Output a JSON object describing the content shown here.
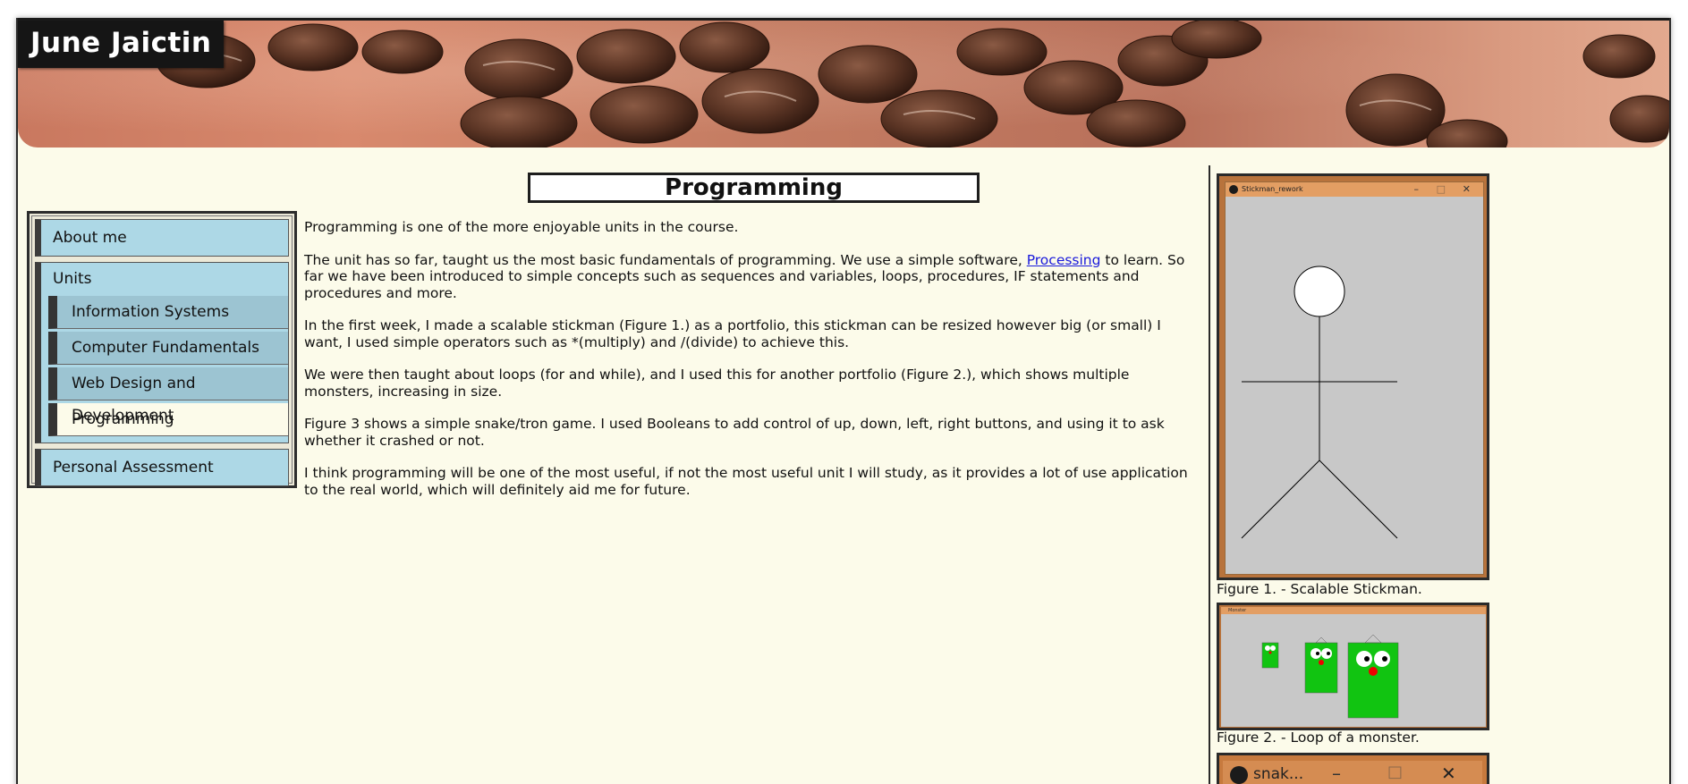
{
  "site": {
    "title": "June Jaictin"
  },
  "nav": {
    "about": "About me",
    "units": {
      "label": "Units",
      "items": [
        {
          "label": "Information Systems"
        },
        {
          "label": "Computer Fundamentals"
        },
        {
          "label": "Web Design and Development"
        },
        {
          "label": "Programming"
        }
      ]
    },
    "assessment": "Personal Assessment"
  },
  "page": {
    "heading": "Programming",
    "p1": "Programming is one of the more enjoyable units in the course.",
    "p2_a": "The unit has so far, taught us the most basic fundamentals of programming. We use a simple software, ",
    "p2_link": "Processing",
    "p2_b": " to learn. So far we have been introduced to simple concepts such as sequences and variables, loops, procedures, IF statements and procedures and more.",
    "p3": "In the first week, I made a scalable stickman (Figure 1.) as a portfolio, this stickman can be resized however big (or small) I want, I used simple operators such as *(multiply) and /(divide) to achieve this.",
    "p4": "We were then taught about loops (for and while), and I used this for another portfolio (Figure 2.), which shows multiple monsters, increasing in size.",
    "p5": "Figure 3 shows a simple snake/tron game. I used Booleans to add control of up, down, left, right buttons, and using it to ask whether it crashed or not.",
    "p6": "I think programming will be one of the most useful, if not the most useful unit I will study, as it provides a lot of use application to the real world, which will definitely aid me for future."
  },
  "figures": [
    {
      "window_title": "Stickman_rework",
      "caption": "Figure 1. - Scalable Stickman."
    },
    {
      "window_title": "Monster",
      "caption": "Figure 2. - Loop of a monster."
    },
    {
      "window_title": "snak..."
    }
  ],
  "colors": {
    "page_bg": "#fcfbea",
    "nav_blue": "#add8e6",
    "title_bg": "#151515",
    "link": "#1a1adb"
  }
}
